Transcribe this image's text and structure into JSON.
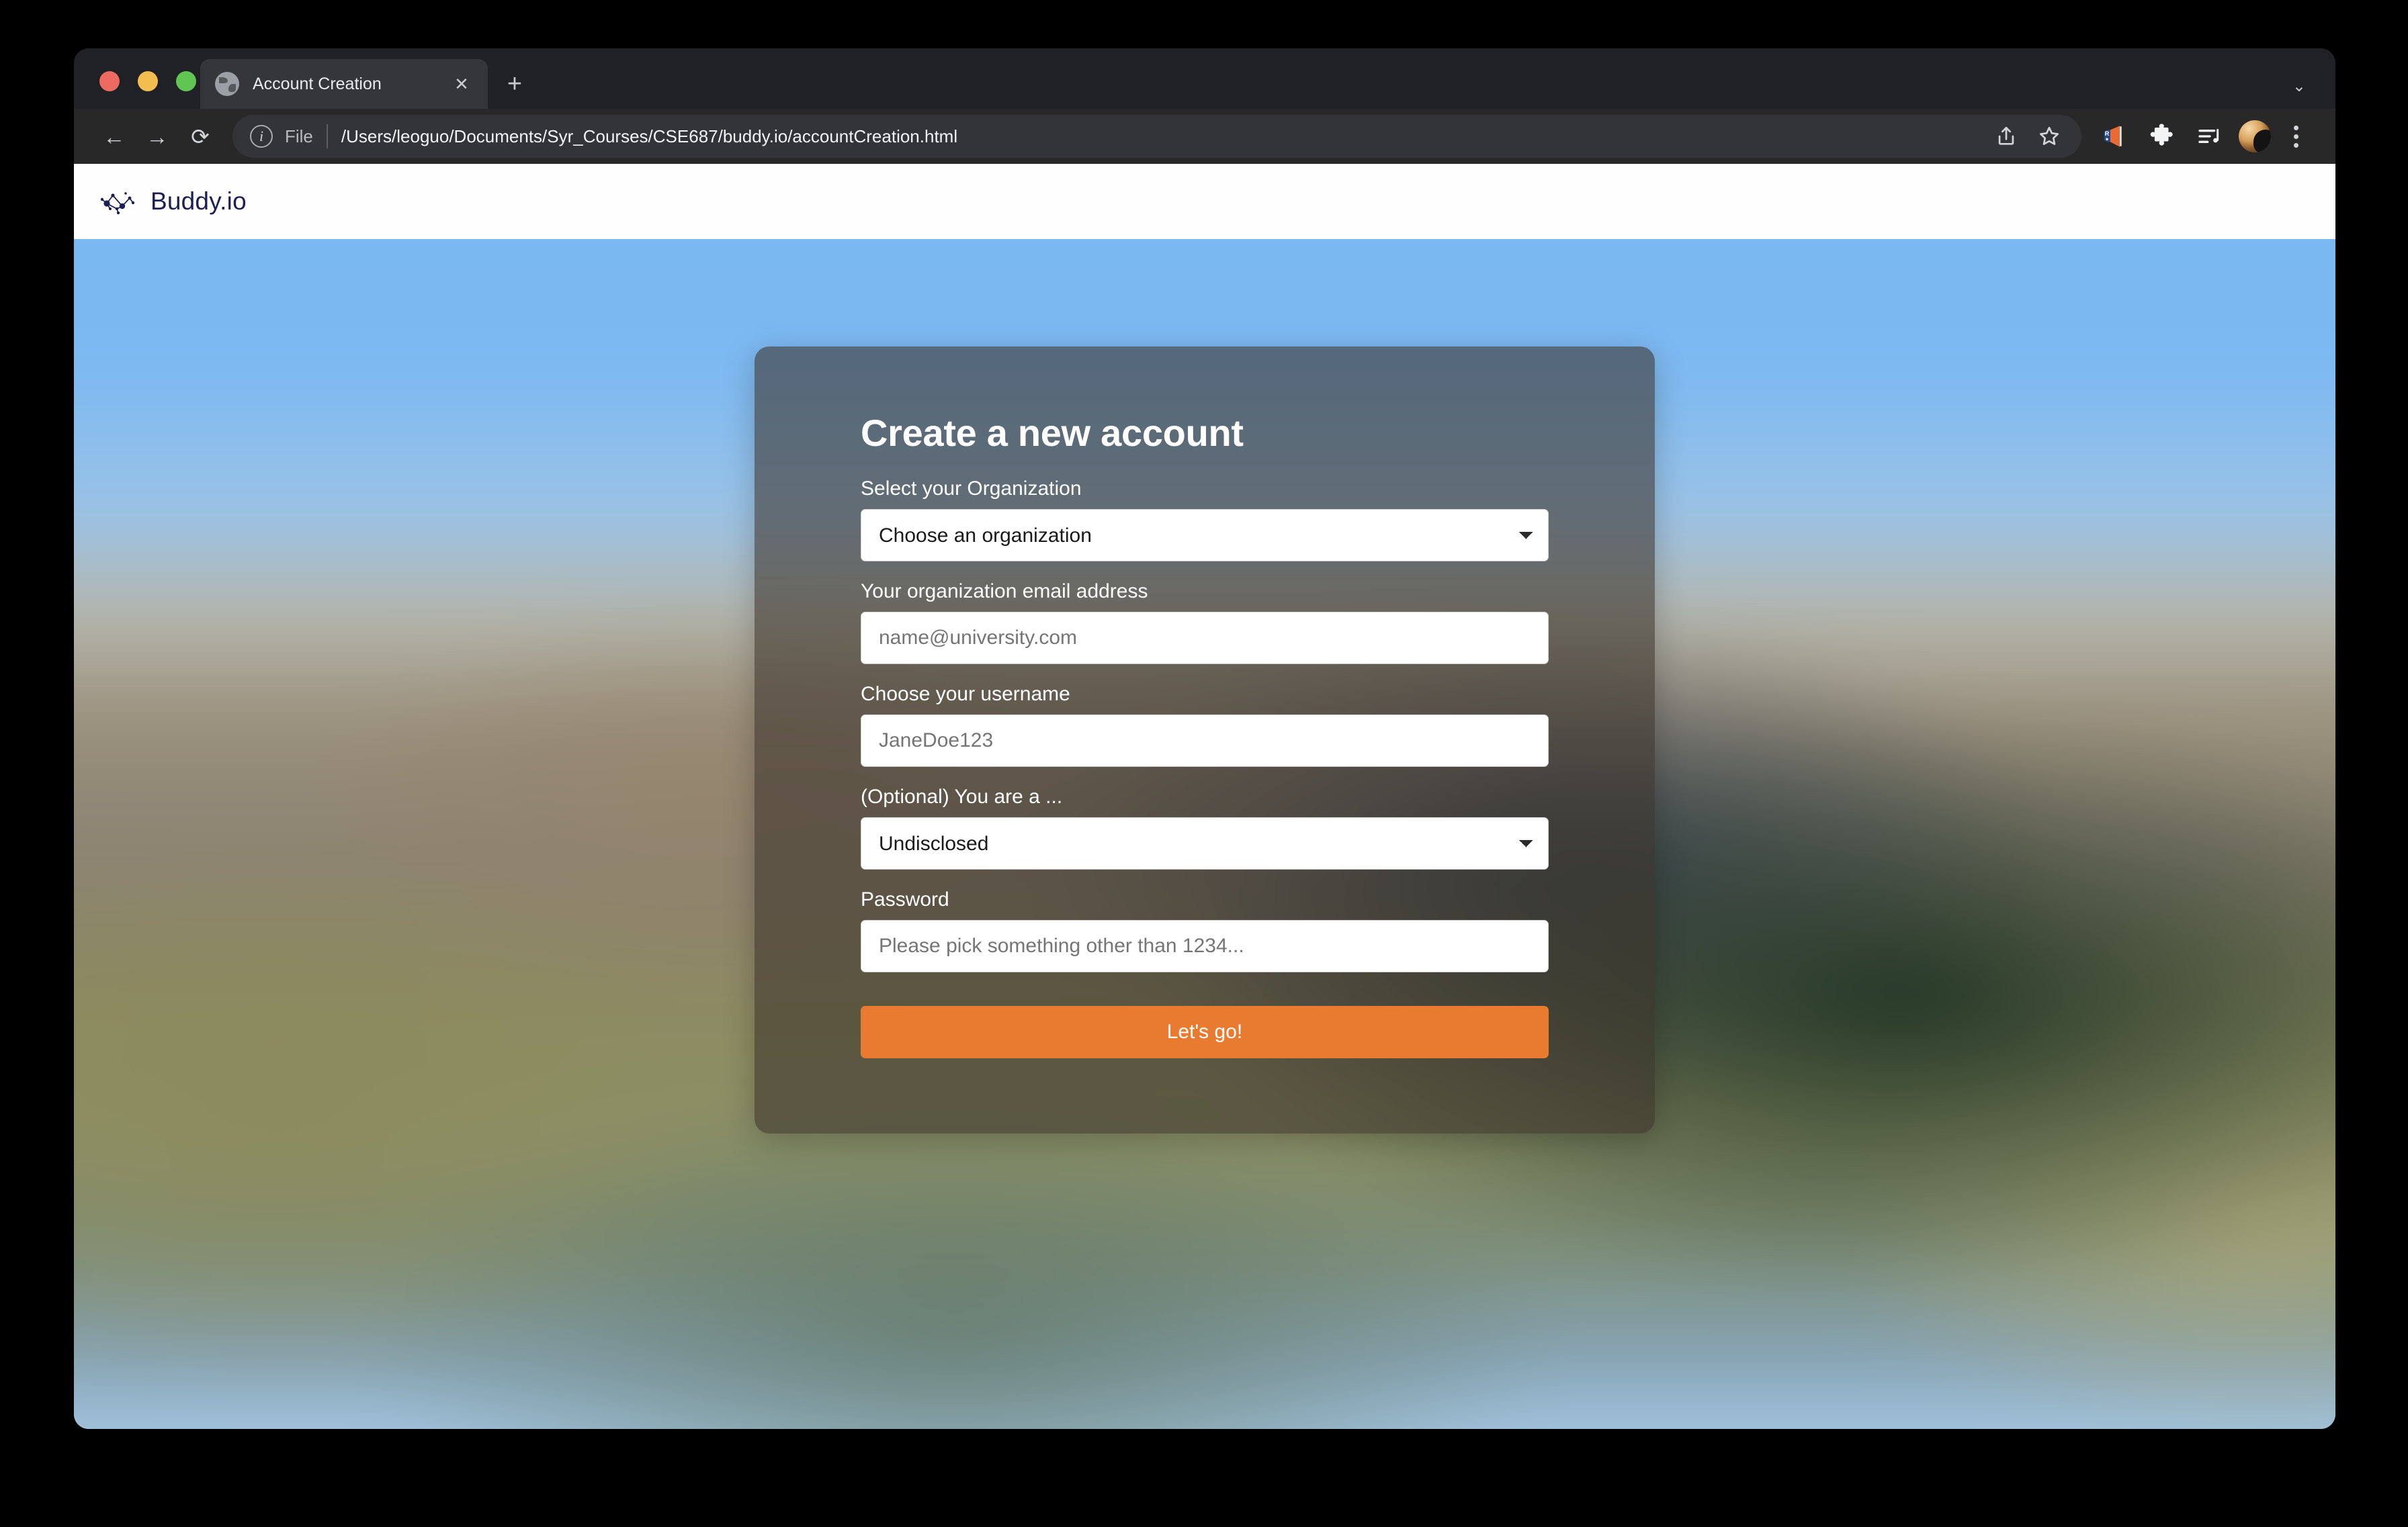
{
  "browser": {
    "tab": {
      "title": "Account Creation",
      "close_label": "✕",
      "favicon": "globe-icon"
    },
    "new_tab_label": "+",
    "tabstrip_chevron": "⌄",
    "nav": {
      "back": "←",
      "forward": "→",
      "reload": "⟳"
    },
    "omnibox": {
      "scheme_label": "File",
      "url": "/Users/leoguo/Documents/Syr_Courses/CSE687/buddy.io/accountCreation.html",
      "info_icon_label": "i"
    },
    "toolbar_icons": [
      "share-icon",
      "bookmark-star-icon",
      "megaphone-icon",
      "extensions-puzzle-icon",
      "media-playlist-icon",
      "profile-avatar",
      "browser-menu-icon"
    ]
  },
  "site": {
    "brand": "Buddy.io",
    "logo": "network-nodes-icon"
  },
  "form": {
    "title": "Create a new account",
    "organization": {
      "label": "Select your Organization",
      "selected": "Choose an organization"
    },
    "email": {
      "label": "Your organization email address",
      "placeholder": "name@university.com",
      "value": ""
    },
    "username": {
      "label": "Choose your username",
      "placeholder": "JaneDoe123",
      "value": ""
    },
    "role": {
      "label": "(Optional) You are a ...",
      "selected": "Undisclosed"
    },
    "password": {
      "label": "Password",
      "placeholder": "Please pick something other than 1234...",
      "value": ""
    },
    "submit_label": "Let's go!"
  },
  "colors": {
    "accent_orange": "#e87b30",
    "brand_navy": "#1b1f55",
    "card_overlay": "rgba(60,52,44,0.60)",
    "sky_blue": "#79b7f2",
    "chrome_dark": "#282828"
  }
}
